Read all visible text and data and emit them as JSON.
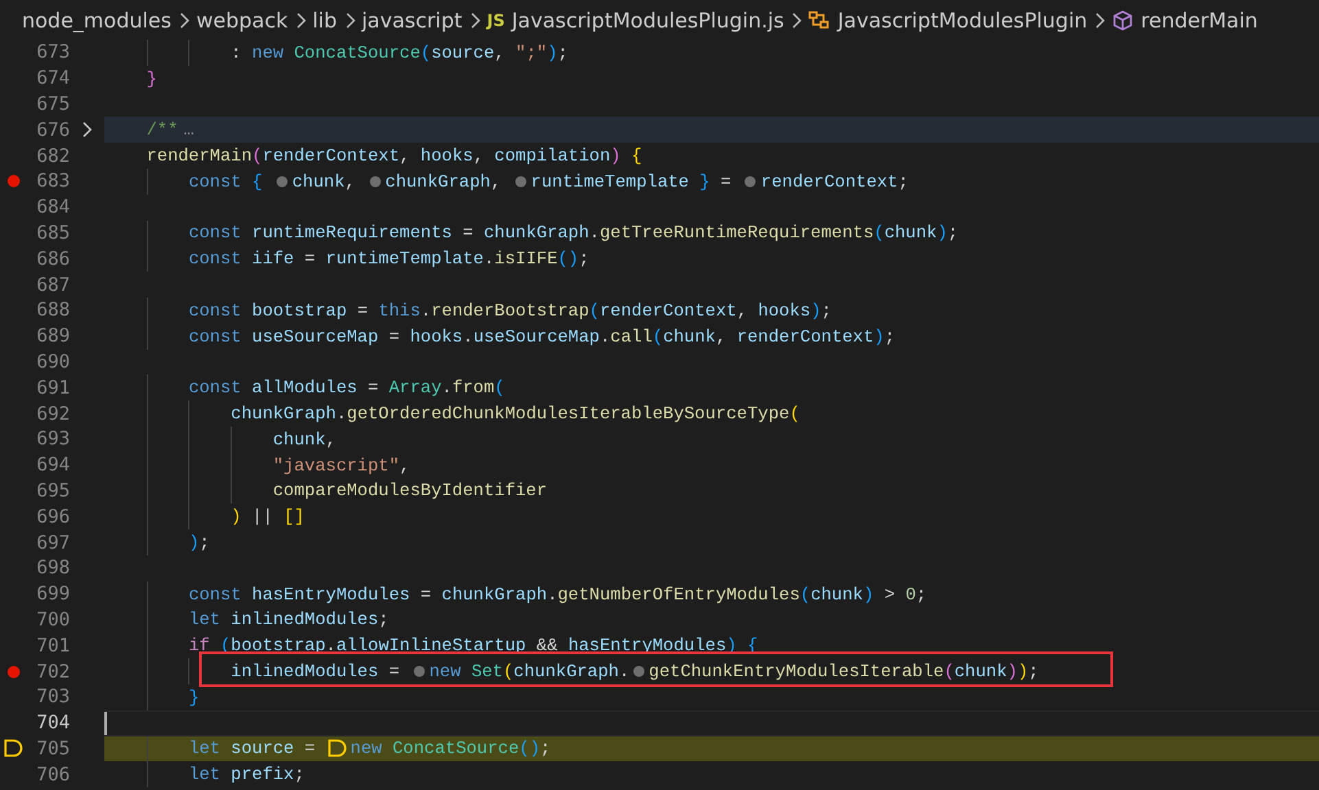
{
  "breadcrumb": [
    {
      "kind": "folder",
      "label": "node_modules"
    },
    {
      "kind": "folder",
      "label": "webpack"
    },
    {
      "kind": "folder",
      "label": "lib"
    },
    {
      "kind": "folder",
      "label": "javascript"
    },
    {
      "kind": "file",
      "label": "JavascriptModulesPlugin.js",
      "icon_text": "JS"
    },
    {
      "kind": "class",
      "label": "JavascriptModulesPlugin"
    },
    {
      "kind": "method",
      "label": "renderMain"
    }
  ],
  "lines": [
    {
      "number": "673",
      "breakpoint": false,
      "paused": false,
      "folded": false,
      "current": false,
      "boxed": false,
      "tokens": [
        {
          "kind": "p",
          "text": "            : "
        },
        {
          "kind": "k",
          "text": "new "
        },
        {
          "kind": "t",
          "text": "ConcatSource"
        },
        {
          "kind": "b3",
          "text": "("
        },
        {
          "kind": "v",
          "text": "source"
        },
        {
          "kind": "p",
          "text": ", "
        },
        {
          "kind": "s",
          "text": "\";\""
        },
        {
          "kind": "b3",
          "text": ")"
        },
        {
          "kind": "p",
          "text": ";"
        }
      ]
    },
    {
      "number": "674",
      "breakpoint": false,
      "paused": false,
      "folded": false,
      "current": false,
      "boxed": false,
      "tokens": [
        {
          "kind": "b2",
          "text": "    }"
        }
      ]
    },
    {
      "number": "675",
      "breakpoint": false,
      "paused": false,
      "folded": false,
      "current": false,
      "boxed": false
    },
    {
      "number": "676",
      "breakpoint": false,
      "paused": false,
      "folded": true,
      "current": false,
      "boxed": false,
      "tokens": [
        {
          "kind": "m",
          "text": "    /**"
        },
        {
          "kind": "e",
          "text": "…"
        }
      ]
    },
    {
      "number": "682",
      "breakpoint": false,
      "paused": false,
      "folded": false,
      "current": false,
      "boxed": false,
      "tokens": [
        {
          "kind": "f",
          "text": "    renderMain"
        },
        {
          "kind": "b2",
          "text": "("
        },
        {
          "kind": "v",
          "text": "renderContext"
        },
        {
          "kind": "p",
          "text": ", "
        },
        {
          "kind": "v",
          "text": "hooks"
        },
        {
          "kind": "p",
          "text": ", "
        },
        {
          "kind": "v",
          "text": "compilation"
        },
        {
          "kind": "b2",
          "text": ") "
        },
        {
          "kind": "b1",
          "text": "{"
        }
      ]
    },
    {
      "number": "683",
      "breakpoint": true,
      "paused": false,
      "folded": false,
      "current": false,
      "boxed": false,
      "tokens": [
        {
          "kind": "k",
          "text": "        const "
        },
        {
          "kind": "b3",
          "text": "{ "
        },
        {
          "kind": "dot"
        },
        {
          "kind": "v",
          "text": "chunk"
        },
        {
          "kind": "p",
          "text": ", "
        },
        {
          "kind": "dot"
        },
        {
          "kind": "v",
          "text": "chunkGraph"
        },
        {
          "kind": "p",
          "text": ", "
        },
        {
          "kind": "dot"
        },
        {
          "kind": "v",
          "text": "runtimeTemplate"
        },
        {
          "kind": "b3",
          "text": " }"
        },
        {
          "kind": "p",
          "text": " = "
        },
        {
          "kind": "dot"
        },
        {
          "kind": "v",
          "text": "renderContext"
        },
        {
          "kind": "p",
          "text": ";"
        }
      ]
    },
    {
      "number": "684",
      "breakpoint": false,
      "paused": false,
      "folded": false,
      "current": false,
      "boxed": false
    },
    {
      "number": "685",
      "breakpoint": false,
      "paused": false,
      "folded": false,
      "current": false,
      "boxed": false,
      "tokens": [
        {
          "kind": "k",
          "text": "        const "
        },
        {
          "kind": "v",
          "text": "runtimeRequirements"
        },
        {
          "kind": "p",
          "text": " = "
        },
        {
          "kind": "v",
          "text": "chunkGraph"
        },
        {
          "kind": "p",
          "text": "."
        },
        {
          "kind": "f",
          "text": "getTreeRuntimeRequirements"
        },
        {
          "kind": "b3",
          "text": "("
        },
        {
          "kind": "v",
          "text": "chunk"
        },
        {
          "kind": "b3",
          "text": ")"
        },
        {
          "kind": "p",
          "text": ";"
        }
      ]
    },
    {
      "number": "686",
      "breakpoint": false,
      "paused": false,
      "folded": false,
      "current": false,
      "boxed": false,
      "tokens": [
        {
          "kind": "k",
          "text": "        const "
        },
        {
          "kind": "v",
          "text": "iife"
        },
        {
          "kind": "p",
          "text": " = "
        },
        {
          "kind": "v",
          "text": "runtimeTemplate"
        },
        {
          "kind": "p",
          "text": "."
        },
        {
          "kind": "f",
          "text": "isIIFE"
        },
        {
          "kind": "b3",
          "text": "()"
        },
        {
          "kind": "p",
          "text": ";"
        }
      ]
    },
    {
      "number": "687",
      "breakpoint": false,
      "paused": false,
      "folded": false,
      "current": false,
      "boxed": false
    },
    {
      "number": "688",
      "breakpoint": false,
      "paused": false,
      "folded": false,
      "current": false,
      "boxed": false,
      "tokens": [
        {
          "kind": "k",
          "text": "        const "
        },
        {
          "kind": "v",
          "text": "bootstrap"
        },
        {
          "kind": "p",
          "text": " = "
        },
        {
          "kind": "k",
          "text": "this"
        },
        {
          "kind": "p",
          "text": "."
        },
        {
          "kind": "f",
          "text": "renderBootstrap"
        },
        {
          "kind": "b3",
          "text": "("
        },
        {
          "kind": "v",
          "text": "renderContext"
        },
        {
          "kind": "p",
          "text": ", "
        },
        {
          "kind": "v",
          "text": "hooks"
        },
        {
          "kind": "b3",
          "text": ")"
        },
        {
          "kind": "p",
          "text": ";"
        }
      ]
    },
    {
      "number": "689",
      "breakpoint": false,
      "paused": false,
      "folded": false,
      "current": false,
      "boxed": false,
      "tokens": [
        {
          "kind": "k",
          "text": "        const "
        },
        {
          "kind": "v",
          "text": "useSourceMap"
        },
        {
          "kind": "p",
          "text": " = "
        },
        {
          "kind": "v",
          "text": "hooks"
        },
        {
          "kind": "p",
          "text": "."
        },
        {
          "kind": "v",
          "text": "useSourceMap"
        },
        {
          "kind": "p",
          "text": "."
        },
        {
          "kind": "f",
          "text": "call"
        },
        {
          "kind": "b3",
          "text": "("
        },
        {
          "kind": "v",
          "text": "chunk"
        },
        {
          "kind": "p",
          "text": ", "
        },
        {
          "kind": "v",
          "text": "renderContext"
        },
        {
          "kind": "b3",
          "text": ")"
        },
        {
          "kind": "p",
          "text": ";"
        }
      ]
    },
    {
      "number": "690",
      "breakpoint": false,
      "paused": false,
      "folded": false,
      "current": false,
      "boxed": false
    },
    {
      "number": "691",
      "breakpoint": false,
      "paused": false,
      "folded": false,
      "current": false,
      "boxed": false,
      "tokens": [
        {
          "kind": "k",
          "text": "        const "
        },
        {
          "kind": "v",
          "text": "allModules"
        },
        {
          "kind": "p",
          "text": " = "
        },
        {
          "kind": "t",
          "text": "Array"
        },
        {
          "kind": "p",
          "text": "."
        },
        {
          "kind": "f",
          "text": "from"
        },
        {
          "kind": "b3",
          "text": "("
        }
      ]
    },
    {
      "number": "692",
      "breakpoint": false,
      "paused": false,
      "folded": false,
      "current": false,
      "boxed": false,
      "tokens": [
        {
          "kind": "v",
          "text": "            chunkGraph"
        },
        {
          "kind": "p",
          "text": "."
        },
        {
          "kind": "f",
          "text": "getOrderedChunkModulesIterableBySourceType"
        },
        {
          "kind": "b1",
          "text": "("
        }
      ]
    },
    {
      "number": "693",
      "breakpoint": false,
      "paused": false,
      "folded": false,
      "current": false,
      "boxed": false,
      "tokens": [
        {
          "kind": "v",
          "text": "                chunk"
        },
        {
          "kind": "p",
          "text": ","
        }
      ]
    },
    {
      "number": "694",
      "breakpoint": false,
      "paused": false,
      "folded": false,
      "current": false,
      "boxed": false,
      "tokens": [
        {
          "kind": "s",
          "text": "                \"javascript\""
        },
        {
          "kind": "p",
          "text": ","
        }
      ]
    },
    {
      "number": "695",
      "breakpoint": false,
      "paused": false,
      "folded": false,
      "current": false,
      "boxed": false,
      "tokens": [
        {
          "kind": "f",
          "text": "                compareModulesByIdentifier"
        }
      ]
    },
    {
      "number": "696",
      "breakpoint": false,
      "paused": false,
      "folded": false,
      "current": false,
      "boxed": false,
      "tokens": [
        {
          "kind": "b1",
          "text": "            )"
        },
        {
          "kind": "p",
          "text": " || "
        },
        {
          "kind": "b1",
          "text": "[]"
        }
      ]
    },
    {
      "number": "697",
      "breakpoint": false,
      "paused": false,
      "folded": false,
      "current": false,
      "boxed": false,
      "tokens": [
        {
          "kind": "b3",
          "text": "        )"
        },
        {
          "kind": "p",
          "text": ";"
        }
      ]
    },
    {
      "number": "698",
      "breakpoint": false,
      "paused": false,
      "folded": false,
      "current": false,
      "boxed": false
    },
    {
      "number": "699",
      "breakpoint": false,
      "paused": false,
      "folded": false,
      "current": false,
      "boxed": false,
      "tokens": [
        {
          "kind": "k",
          "text": "        const "
        },
        {
          "kind": "v",
          "text": "hasEntryModules"
        },
        {
          "kind": "p",
          "text": " = "
        },
        {
          "kind": "v",
          "text": "chunkGraph"
        },
        {
          "kind": "p",
          "text": "."
        },
        {
          "kind": "f",
          "text": "getNumberOfEntryModules"
        },
        {
          "kind": "b3",
          "text": "("
        },
        {
          "kind": "v",
          "text": "chunk"
        },
        {
          "kind": "b3",
          "text": ")"
        },
        {
          "kind": "p",
          "text": " > "
        },
        {
          "kind": "n",
          "text": "0"
        },
        {
          "kind": "p",
          "text": ";"
        }
      ]
    },
    {
      "number": "700",
      "breakpoint": false,
      "paused": false,
      "folded": false,
      "current": false,
      "boxed": false,
      "tokens": [
        {
          "kind": "k",
          "text": "        let "
        },
        {
          "kind": "v",
          "text": "inlinedModules"
        },
        {
          "kind": "p",
          "text": ";"
        }
      ]
    },
    {
      "number": "701",
      "breakpoint": false,
      "paused": false,
      "folded": false,
      "current": false,
      "boxed": false,
      "tokens": [
        {
          "kind": "c",
          "text": "        if "
        },
        {
          "kind": "b3",
          "text": "("
        },
        {
          "kind": "v",
          "text": "bootstrap"
        },
        {
          "kind": "p",
          "text": "."
        },
        {
          "kind": "v",
          "text": "allowInlineStartup"
        },
        {
          "kind": "p",
          "text": " && "
        },
        {
          "kind": "v",
          "text": "hasEntryModules"
        },
        {
          "kind": "b3",
          "text": ") {"
        }
      ]
    },
    {
      "number": "702",
      "breakpoint": true,
      "paused": false,
      "folded": false,
      "current": false,
      "boxed": true,
      "tokens": [
        {
          "kind": "v",
          "text": "            inlinedModules"
        },
        {
          "kind": "p",
          "text": " = "
        },
        {
          "kind": "dot"
        },
        {
          "kind": "k",
          "text": "new "
        },
        {
          "kind": "t",
          "text": "Set"
        },
        {
          "kind": "b1",
          "text": "("
        },
        {
          "kind": "v",
          "text": "chunkGraph"
        },
        {
          "kind": "p",
          "text": "."
        },
        {
          "kind": "dot"
        },
        {
          "kind": "f",
          "text": "getChunkEntryModulesIterable"
        },
        {
          "kind": "b2",
          "text": "("
        },
        {
          "kind": "v",
          "text": "chunk"
        },
        {
          "kind": "b2",
          "text": ")"
        },
        {
          "kind": "b1",
          "text": ")"
        },
        {
          "kind": "p",
          "text": ";"
        }
      ]
    },
    {
      "number": "703",
      "breakpoint": false,
      "paused": false,
      "folded": false,
      "current": false,
      "boxed": false,
      "tokens": [
        {
          "kind": "b3",
          "text": "        }"
        }
      ]
    },
    {
      "number": "704",
      "breakpoint": false,
      "paused": false,
      "folded": false,
      "current": true,
      "boxed": false
    },
    {
      "number": "705",
      "breakpoint": false,
      "paused": true,
      "folded": false,
      "current": false,
      "boxed": false,
      "tokens": [
        {
          "kind": "k",
          "text": "        let "
        },
        {
          "kind": "v",
          "text": "source"
        },
        {
          "kind": "p",
          "text": " = "
        },
        {
          "kind": "stop"
        },
        {
          "kind": "k",
          "text": "new "
        },
        {
          "kind": "t",
          "text": "ConcatSource"
        },
        {
          "kind": "b3",
          "text": "()"
        },
        {
          "kind": "p",
          "text": ";"
        }
      ]
    },
    {
      "number": "706",
      "breakpoint": false,
      "paused": false,
      "folded": false,
      "current": false,
      "boxed": false,
      "tokens": [
        {
          "kind": "k",
          "text": "        let "
        },
        {
          "kind": "v",
          "text": "prefix"
        },
        {
          "kind": "p",
          "text": ";"
        }
      ]
    }
  ]
}
